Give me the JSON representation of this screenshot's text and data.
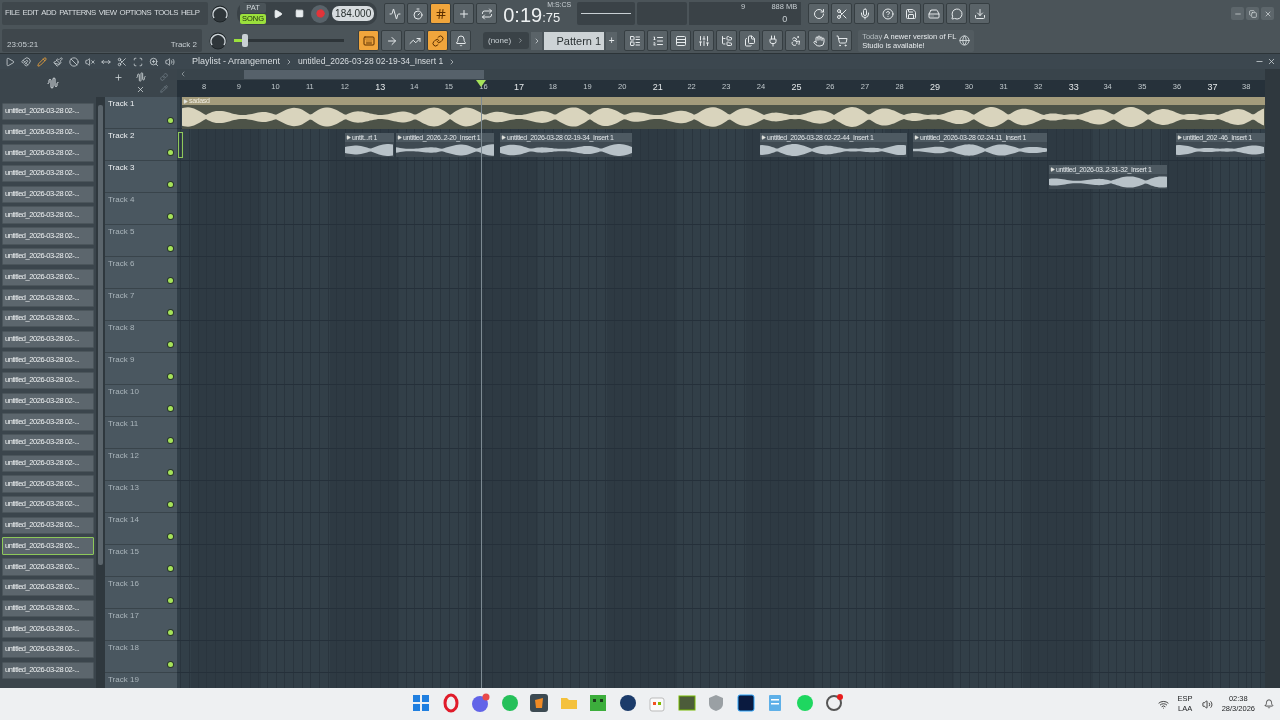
{
  "menu": [
    "FILE",
    "EDIT",
    "ADD",
    "PATTERNS",
    "VIEW",
    "OPTIONS",
    "TOOLS",
    "HELP"
  ],
  "hint": {
    "time": "23:05:21",
    "target": "Track 2"
  },
  "transport": {
    "modes": [
      {
        "label": "PAT",
        "selected": false
      },
      {
        "label": "SONG",
        "selected": true
      }
    ],
    "tempo": "184.000"
  },
  "master_pitch": {
    "level": 0.08
  },
  "toggles_top": [
    {
      "kind": "pulse",
      "on": false
    },
    {
      "kind": "timer",
      "on": false
    },
    {
      "kind": "countdown",
      "on": true
    },
    {
      "kind": "step",
      "on": false
    },
    {
      "kind": "loop",
      "on": false
    }
  ],
  "toggles_bottom": [
    {
      "kind": "typing",
      "on": true
    },
    {
      "kind": "arrow",
      "on": false
    },
    {
      "kind": "curve",
      "on": false
    },
    {
      "kind": "link",
      "on": true
    },
    {
      "kind": "bell",
      "on": false
    }
  ],
  "time": {
    "main": "0:19",
    "fraction": ":75",
    "unit": "M:S:CS"
  },
  "resources": {
    "cpu": "9",
    "memory": "888 MB",
    "polyphony": "0"
  },
  "pattern": {
    "channel": "(none)",
    "name": "Pattern 1",
    "add": "+"
  },
  "news": {
    "when": "Today",
    "message": "A newer version of FL Studio is available!"
  },
  "tools": [
    {
      "kind": "play",
      "selected": false
    },
    {
      "kind": "magnet",
      "selected": false
    },
    {
      "kind": "pencil",
      "selected": true
    },
    {
      "kind": "brush",
      "selected": false
    },
    {
      "kind": "ban",
      "selected": false
    },
    {
      "kind": "mute",
      "selected": false
    },
    {
      "kind": "slip",
      "selected": false
    },
    {
      "kind": "slice",
      "selected": false
    },
    {
      "kind": "select",
      "selected": false
    },
    {
      "kind": "zoom",
      "selected": false
    },
    {
      "kind": "listen",
      "selected": false
    }
  ],
  "playlist": {
    "title": "Playlist - Arrangement",
    "breadcrumb": "untitled_2026-03-28 02-19-34_Insert 1",
    "ruler": [
      {
        "label": "8",
        "major": false
      },
      {
        "label": "9",
        "major": false
      },
      {
        "label": "10",
        "major": false
      },
      {
        "label": "11",
        "major": false
      },
      {
        "label": "12",
        "major": false
      },
      {
        "label": "13",
        "major": true
      },
      {
        "label": "14",
        "major": false
      },
      {
        "label": "15",
        "major": false
      },
      {
        "label": "16",
        "major": false
      },
      {
        "label": "17",
        "major": true
      },
      {
        "label": "18",
        "major": false
      },
      {
        "label": "19",
        "major": false
      },
      {
        "label": "20",
        "major": false
      },
      {
        "label": "21",
        "major": true
      },
      {
        "label": "22",
        "major": false
      },
      {
        "label": "23",
        "major": false
      },
      {
        "label": "24",
        "major": false
      },
      {
        "label": "25",
        "major": true
      },
      {
        "label": "26",
        "major": false
      },
      {
        "label": "27",
        "major": false
      },
      {
        "label": "28",
        "major": false
      },
      {
        "label": "29",
        "major": true
      },
      {
        "label": "30",
        "major": false
      },
      {
        "label": "31",
        "major": false
      },
      {
        "label": "32",
        "major": false
      },
      {
        "label": "33",
        "major": true
      },
      {
        "label": "34",
        "major": false
      },
      {
        "label": "35",
        "major": false
      },
      {
        "label": "36",
        "major": false
      },
      {
        "label": "37",
        "major": true
      },
      {
        "label": "38",
        "major": false
      }
    ],
    "tracks": [
      {
        "name": "Track 1",
        "selected": false,
        "enabled": true,
        "clips": [
          {
            "label": "sadasd",
            "kind": "pattern"
          }
        ]
      },
      {
        "name": "Track 2",
        "selected": true,
        "enabled": true,
        "clips": [
          {
            "label": "untit...rt 1",
            "kind": "audio"
          },
          {
            "label": "untitled_2026..2-20_Insert 1",
            "kind": "audio"
          },
          {
            "label": "untitled_2026-03-28 02-19-34_Insert 1",
            "kind": "audio"
          },
          {
            "label": "untitled_2026-03-28 02-22-44_Insert 1",
            "kind": "audio"
          },
          {
            "label": "untitled_2026-03-28 02-24-11_Insert 1",
            "kind": "audio"
          },
          {
            "label": "untitled_202  -46_Insert 1",
            "kind": "audio"
          }
        ]
      },
      {
        "name": "Track 3",
        "selected": false,
        "enabled": true,
        "clips": [
          {
            "label": "untitled_2026-03..2-31-32_Insert 1",
            "kind": "audio"
          }
        ]
      },
      {
        "name": "Track 4",
        "selected": false,
        "enabled": true
      },
      {
        "name": "Track 5",
        "selected": false,
        "enabled": true
      },
      {
        "name": "Track 6",
        "selected": false,
        "enabled": true
      },
      {
        "name": "Track 7",
        "selected": false,
        "enabled": true
      },
      {
        "name": "Track 8",
        "selected": false,
        "enabled": true
      },
      {
        "name": "Track 9",
        "selected": false,
        "enabled": true
      },
      {
        "name": "Track 10",
        "selected": false,
        "enabled": true
      },
      {
        "name": "Track 11",
        "selected": false,
        "enabled": true
      },
      {
        "name": "Track 12",
        "selected": false,
        "enabled": true
      },
      {
        "name": "Track 13",
        "selected": false,
        "enabled": true
      },
      {
        "name": "Track 14",
        "selected": false,
        "enabled": true
      },
      {
        "name": "Track 15",
        "selected": false,
        "enabled": true
      },
      {
        "name": "Track 16",
        "selected": false,
        "enabled": true
      },
      {
        "name": "Track 17",
        "selected": false,
        "enabled": true
      },
      {
        "name": "Track 18",
        "selected": false,
        "enabled": true
      },
      {
        "name": "Track 19",
        "selected": false
      }
    ]
  },
  "browser": {
    "items": [
      {
        "label": "untitled_2026-03-28 02-...",
        "selected": false
      },
      {
        "label": "untitled_2026-03-28 02-...",
        "selected": false
      },
      {
        "label": "untitled_2026-03-28 02-...",
        "selected": false
      },
      {
        "label": "untitled_2026-03-28 02-...",
        "selected": false
      },
      {
        "label": "untitled_2026-03-28 02-...",
        "selected": false
      },
      {
        "label": "untitled_2026-03-28 02-...",
        "selected": false
      },
      {
        "label": "untitled_2026-03-28 02-...",
        "selected": false
      },
      {
        "label": "untitled_2026-03-28 02-...",
        "selected": false
      },
      {
        "label": "untitled_2026-03-28 02-...",
        "selected": false
      },
      {
        "label": "untitled_2026-03-28 02-...",
        "selected": false
      },
      {
        "label": "untitled_2026-03-28 02-...",
        "selected": false
      },
      {
        "label": "untitled_2026-03-28 02-...",
        "selected": false
      },
      {
        "label": "untitled_2026-03-28 02-...",
        "selected": false
      },
      {
        "label": "untitled_2026-03-28 02-...",
        "selected": false
      },
      {
        "label": "untitled_2026-03-28 02-...",
        "selected": false
      },
      {
        "label": "untitled_2026-03-28 02-...",
        "selected": false
      },
      {
        "label": "untitled_2026-03-28 02-...",
        "selected": false
      },
      {
        "label": "untitled_2026-03-28 02-...",
        "selected": false
      },
      {
        "label": "untitled_2026-03-28 02-...",
        "selected": false
      },
      {
        "label": "untitled_2026-03-28 02-...",
        "selected": false
      },
      {
        "label": "untitled_2026-03-28 02-...",
        "selected": false
      },
      {
        "label": "untitled_2026-03-28 02-...",
        "selected": true
      },
      {
        "label": "untitled_2026-03-28 02-...",
        "selected": false
      },
      {
        "label": "untitled_2026-03-28 02-...",
        "selected": false
      },
      {
        "label": "untitled_2026-03-28 02-...",
        "selected": false
      },
      {
        "label": "untitled_2026-03-28 02-...",
        "selected": false
      },
      {
        "label": "untitled_2026-03-28 02-...",
        "selected": false
      },
      {
        "label": "untitled_2026-03-28 02-...",
        "selected": false
      }
    ]
  },
  "tray": {
    "language": "ESP",
    "layout": "LAA",
    "time": "02:38",
    "date": "28/3/2026"
  }
}
